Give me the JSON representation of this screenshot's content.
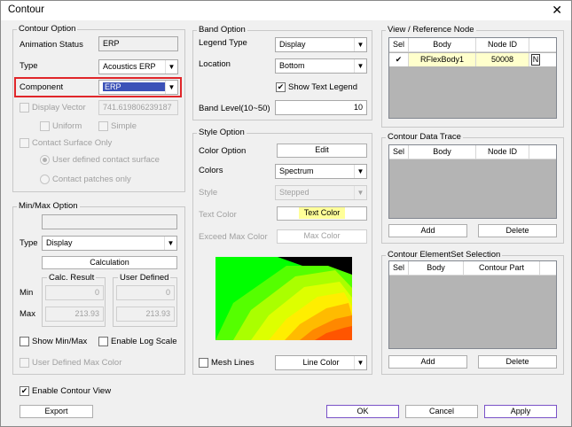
{
  "window": {
    "title": "Contour"
  },
  "contour_option": {
    "title": "Contour Option",
    "animation_status_label": "Animation Status",
    "animation_status_value": "ERP",
    "type_label": "Type",
    "type_value": "Acoustics ERP",
    "component_label": "Component",
    "component_value": "ERP",
    "display_vector_label": "Display Vector",
    "display_vector_value": "741.619806239187",
    "uniform_label": "Uniform",
    "simple_label": "Simple",
    "contact_surface_only_label": "Contact Surface Only",
    "user_defined_surface_label": "User defined contact surface",
    "contact_patches_label": "Contact patches only"
  },
  "minmax_option": {
    "title": "Min/Max Option",
    "type_label": "Type",
    "type_value": "Display",
    "calculation_button": "Calculation",
    "calc_result_title": "Calc. Result",
    "user_defined_title": "User Defined",
    "min_label": "Min",
    "max_label": "Max",
    "calc_min": "0",
    "calc_max": "213.93",
    "user_min": "0",
    "user_max": "213.93",
    "show_minmax_label": "Show Min/Max",
    "enable_log_scale_label": "Enable Log Scale",
    "user_defined_max_color_label": "User Defined Max Color"
  },
  "band_option": {
    "title": "Band Option",
    "legend_type_label": "Legend Type",
    "legend_type_value": "Display",
    "location_label": "Location",
    "location_value": "Bottom",
    "show_text_legend_label": "Show Text Legend",
    "band_level_label": "Band Level(10~50)",
    "band_level_value": "10"
  },
  "style_option": {
    "title": "Style Option",
    "color_option_label": "Color Option",
    "edit_button": "Edit",
    "colors_label": "Colors",
    "colors_value": "Spectrum",
    "style_label": "Style",
    "style_value": "Stepped",
    "text_color_label": "Text Color",
    "text_color_button": "Text Color",
    "exceed_max_color_label": "Exceed Max Color",
    "max_color_button": "Max Color",
    "mesh_lines_label": "Mesh Lines",
    "line_color_button": "Line Color"
  },
  "view_reference_node": {
    "title": "View / Reference Node",
    "columns": [
      "Sel",
      "Body",
      "Node ID"
    ],
    "rows": [
      {
        "sel": "✔",
        "body": "RFlexBody1",
        "node_id": "50008",
        "extra": "N"
      }
    ]
  },
  "contour_data_trace": {
    "title": "Contour Data Trace",
    "columns": [
      "Sel",
      "Body",
      "Node ID"
    ],
    "add_button": "Add",
    "delete_button": "Delete"
  },
  "contour_elementset": {
    "title": "Contour ElementSet Selection",
    "columns": [
      "Sel",
      "Body",
      "Contour Part"
    ],
    "add_button": "Add",
    "delete_button": "Delete"
  },
  "footer": {
    "enable_contour_view_label": "Enable Contour View",
    "export_button": "Export",
    "ok_button": "OK",
    "cancel_button": "Cancel",
    "apply_button": "Apply"
  },
  "colors": {
    "highlight": "#e0262a",
    "selection": "#3c52b8",
    "accent": "#7a52c8"
  }
}
